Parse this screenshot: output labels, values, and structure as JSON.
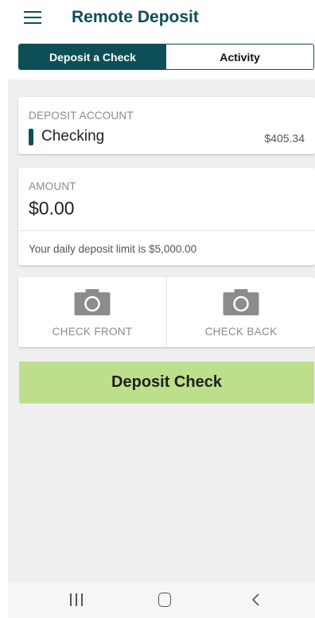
{
  "header": {
    "title": "Remote Deposit",
    "menu_icon": "hamburger-menu-icon"
  },
  "tabs": [
    {
      "label": "Deposit a Check",
      "active": true
    },
    {
      "label": "Activity",
      "active": false
    }
  ],
  "deposit_account": {
    "caption": "DEPOSIT ACCOUNT",
    "name": "Checking",
    "balance": "$405.34"
  },
  "amount": {
    "caption": "AMOUNT",
    "value": "$0.00",
    "limit_text": "Your daily deposit limit is $5,000.00"
  },
  "photos": {
    "front_label": "CHECK FRONT",
    "back_label": "CHECK BACK",
    "icon": "camera-icon"
  },
  "actions": {
    "deposit_label": "Deposit Check"
  },
  "colors": {
    "brand": "#0e4e57",
    "deposit_button": "#bddf8b",
    "background": "#efefef"
  },
  "system_nav": {
    "recent_icon": "recent-apps-icon",
    "home_icon": "home-icon",
    "back_icon": "back-icon"
  }
}
